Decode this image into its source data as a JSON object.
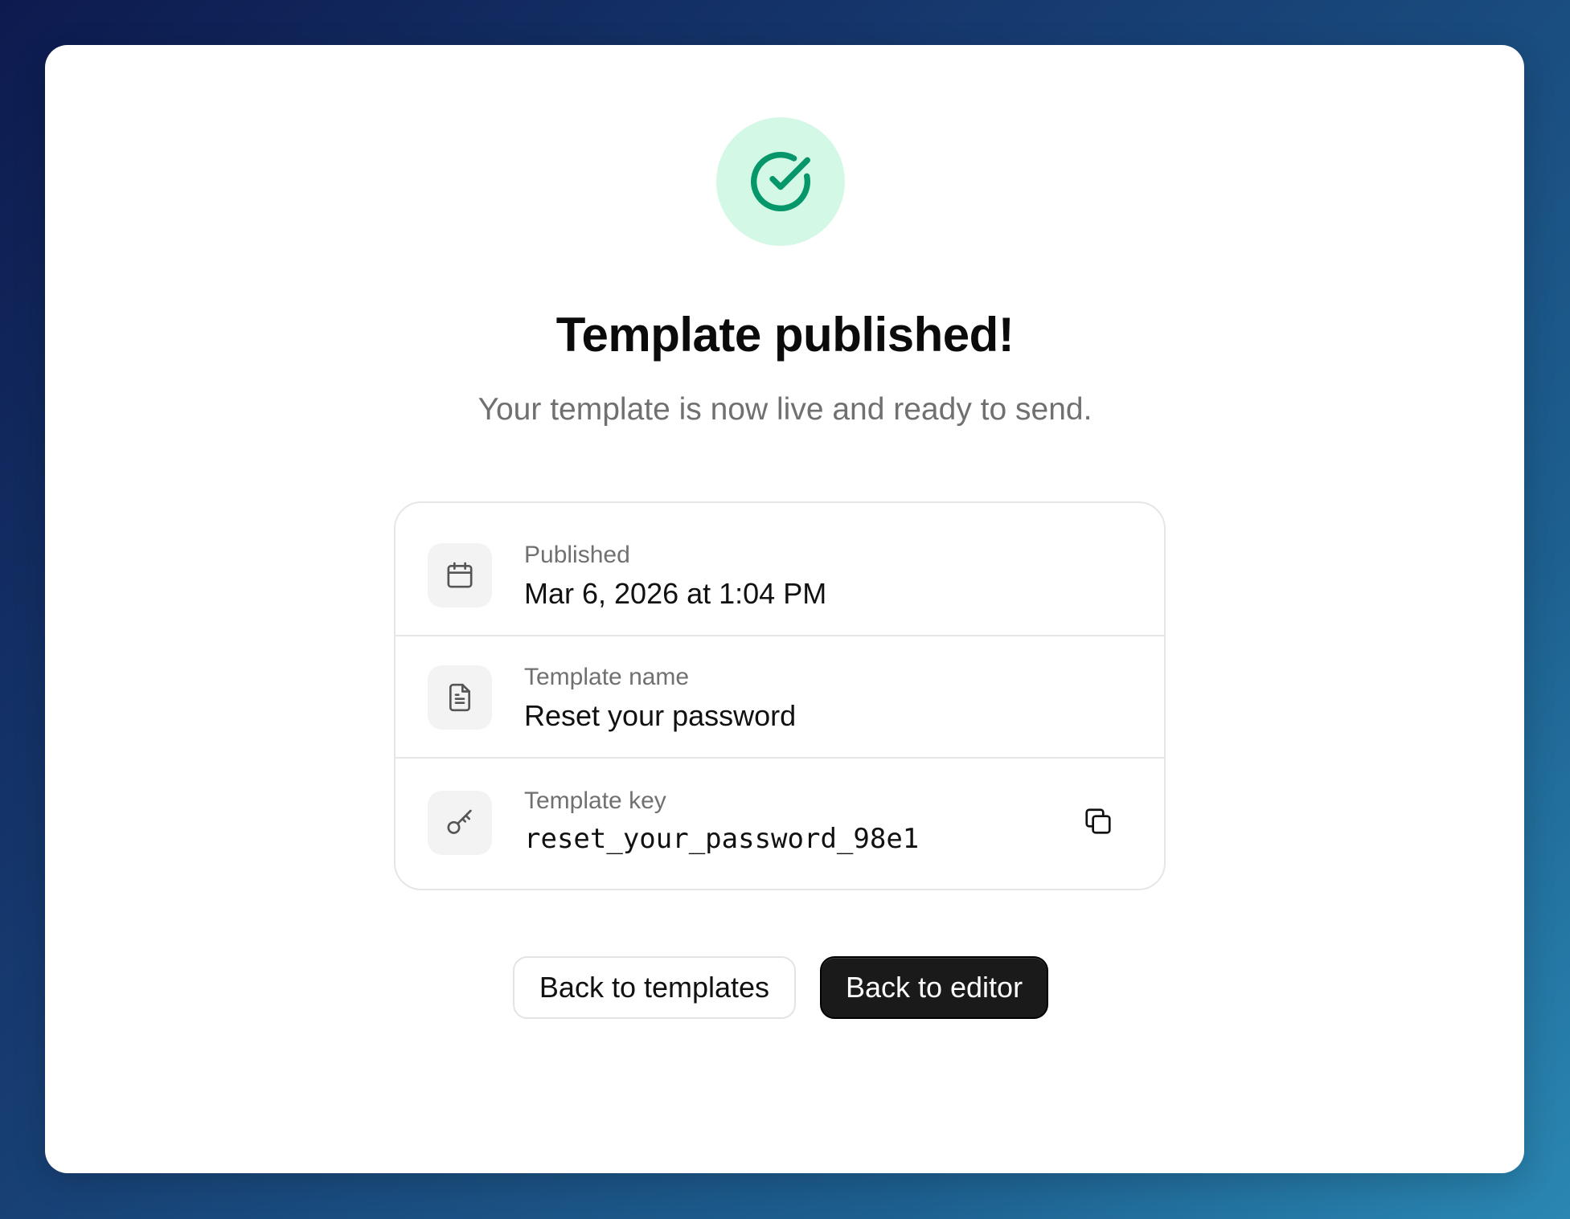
{
  "status": {
    "icon": "check-circle-icon",
    "accent_color": "#059669",
    "badge_bg": "#d4f8e6"
  },
  "header": {
    "title": "Template published!",
    "subtitle": "Your template is now live and ready to send."
  },
  "details": {
    "published": {
      "icon": "calendar-icon",
      "label": "Published",
      "value": "Mar 6, 2026 at 1:04 PM"
    },
    "name": {
      "icon": "document-icon",
      "label": "Template name",
      "value": "Reset your password"
    },
    "key": {
      "icon": "key-icon",
      "label": "Template key",
      "value": "reset_your_password_98e1",
      "copy_icon": "copy-icon"
    }
  },
  "actions": {
    "secondary_label": "Back to templates",
    "primary_label": "Back to editor"
  }
}
